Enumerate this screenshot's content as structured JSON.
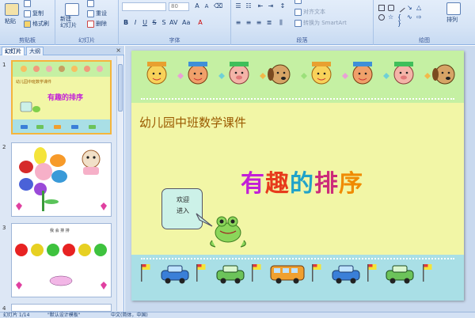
{
  "ribbon": {
    "clipboard": {
      "group_label": "剪贴板",
      "paste_label": "粘贴",
      "copy_label": "复制",
      "format_painter_label": "格式刷"
    },
    "slides": {
      "group_label": "幻灯片",
      "new_slide_label": "新建\n幻灯片",
      "reset_label": "重设",
      "delete_label": "删除"
    },
    "font": {
      "group_label": "字体",
      "size_value": "80"
    },
    "paragraph": {
      "group_label": "段落",
      "align_text_label": "对齐文本",
      "convert_smartart_label": "转换为 SmartArt"
    },
    "drawing": {
      "group_label": "绘图",
      "arrange_label": "排列"
    }
  },
  "panel": {
    "tabs": [
      {
        "label": "幻灯片"
      },
      {
        "label": "大纲"
      }
    ],
    "close_glyph": "×",
    "thumbnails": [
      {
        "number": "1",
        "subtitle": "幼儿园中班数学课件",
        "title": "有趣的排序"
      },
      {
        "number": "2"
      },
      {
        "number": "3",
        "header_text": "我 会 排 排"
      },
      {
        "number": "4"
      }
    ]
  },
  "slide": {
    "subtitle": "幼儿园中班数学课件",
    "title_chars": [
      {
        "char": "有",
        "color": "#c21fd8"
      },
      {
        "char": "趣",
        "color": "#e73b1c"
      },
      {
        "char": "的",
        "color": "#21a3c9"
      },
      {
        "char": "排",
        "color": "#cc2a7a"
      },
      {
        "char": "序",
        "color": "#f08a00"
      }
    ],
    "bubble_line1": "欢迎",
    "bubble_line2": "进入"
  },
  "status": {
    "slide_count": "幻灯片 1/14",
    "theme": "\"默认设计模板\"",
    "language": "中文(简体，中国)"
  }
}
